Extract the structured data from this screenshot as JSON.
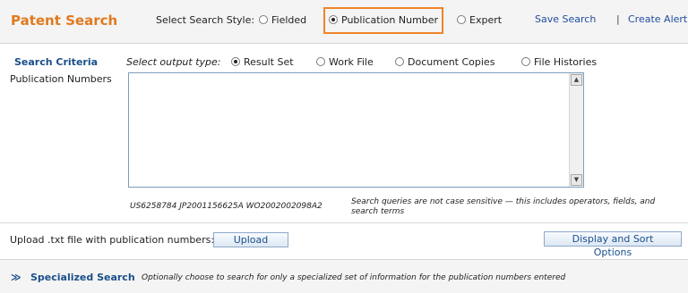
{
  "header": {
    "title": "Patent Search",
    "style_label": "Select Search Style:",
    "styles": [
      {
        "label": "Fielded",
        "checked": false
      },
      {
        "label": "Publication Number",
        "checked": true
      },
      {
        "label": "Expert",
        "checked": false
      }
    ],
    "save_search": "Save Search",
    "separator": "|",
    "create_alert": "Create Alert"
  },
  "criteria": {
    "title": "Search Criteria",
    "output_label": "Select output type:",
    "outputs": [
      {
        "label": "Result Set",
        "checked": true
      },
      {
        "label": "Work File",
        "checked": false
      },
      {
        "label": "Document Copies",
        "checked": false
      },
      {
        "label": "File Histories",
        "checked": false
      }
    ],
    "field_label": "Publication Numbers",
    "field_value": "",
    "example": "US6258784 JP2001156625A WO2002002098A2",
    "hint_line1": "Search queries are not case sensitive — this includes operators, fields, and",
    "hint_line2": "search terms"
  },
  "upload": {
    "label": "Upload .txt file with publication numbers:",
    "button": "Upload"
  },
  "display_sort_button": "Display and Sort Options",
  "specialized": {
    "title": "Specialized Search",
    "description": "Optionally choose to search for only a specialized set of information for the publication numbers entered"
  },
  "icons": {
    "collapse": "double-chevron-down-icon",
    "scroll_up": "scroll-up-arrow-icon",
    "scroll_down": "scroll-down-arrow-icon"
  },
  "colors": {
    "title": "#e07a1f",
    "highlight_box": "#f0842a",
    "link": "#1f4d9e",
    "section_title": "#1a4f8a"
  }
}
